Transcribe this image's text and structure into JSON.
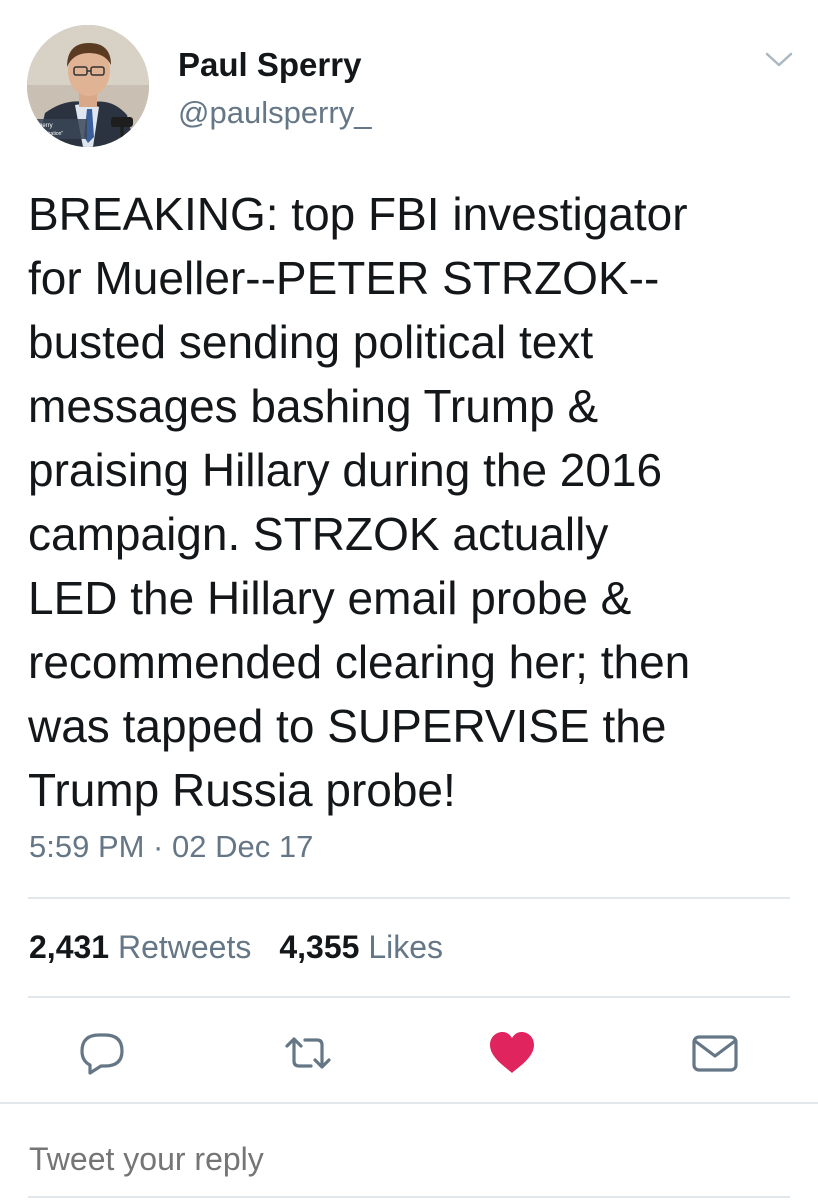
{
  "author": {
    "name": "Paul Sperry",
    "handle": "@paulsperry_"
  },
  "tweet": {
    "text": "BREAKING: top FBI investigator\nfor Mueller--PETER STRZOK--\nbusted sending political text\nmessages bashing Trump &\npraising Hillary during the 2016\ncampaign. STRZOK actually\nLED the Hillary email probe &\nrecommended clearing her; then\nwas tapped to SUPERVISE the\nTrump Russia probe!",
    "timestamp": "5:59 PM · 02 Dec 17"
  },
  "stats": {
    "retweets_count": "2,431",
    "retweets_label": "Retweets",
    "likes_count": "4,355",
    "likes_label": "Likes"
  },
  "actions": {
    "icons": [
      "reply-icon",
      "retweet-icon",
      "heart-icon",
      "direct-message-icon"
    ],
    "liked": true,
    "like_color": "#e0245e",
    "icon_color": "#657786"
  },
  "reply": {
    "placeholder": "Tweet your reply"
  },
  "avatar_caption": {
    "line1": "Sperry",
    "line2": "or, \"Infiltration\""
  },
  "colors": {
    "text": "#14171a",
    "secondary": "#657786",
    "divider": "#e1e8ed"
  }
}
